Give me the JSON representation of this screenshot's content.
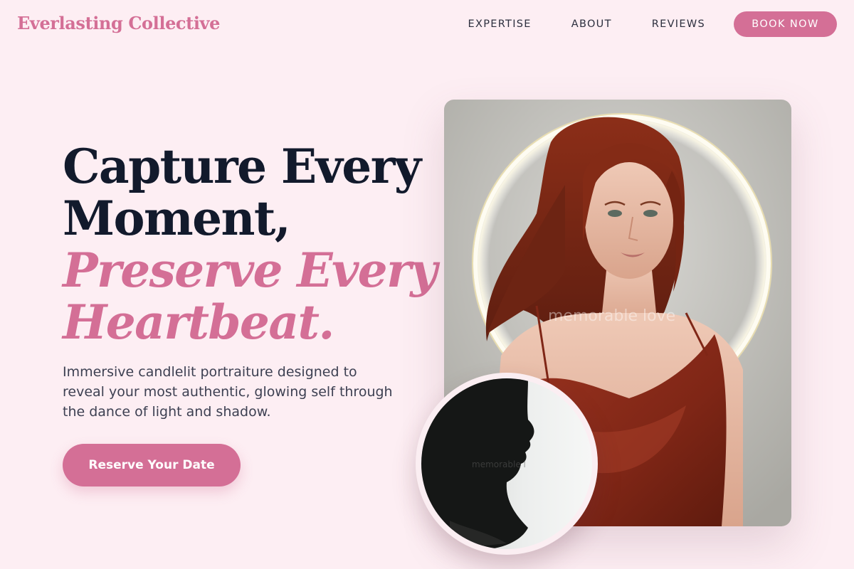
{
  "brand": {
    "name": "Everlasting Collective",
    "accent": "#d46f96"
  },
  "nav": {
    "items": [
      {
        "label": "EXPERTISE"
      },
      {
        "label": "ABOUT"
      },
      {
        "label": "REVIEWS"
      }
    ],
    "cta_label": "BOOK NOW"
  },
  "hero": {
    "title_line1": "Capture Every",
    "title_line2": "Moment,",
    "accent_line1": "Preserve Every",
    "accent_line2": "Heartbeat.",
    "subtitle": "Immersive candlelit portraiture designed to reveal your most authentic, glowing self through the dance of light and shadow.",
    "cta_label": "Reserve Your Date"
  },
  "photos": {
    "main": {
      "subject": "red-haired woman in rust satin dress with glowing halo ring",
      "watermark": "memorable love"
    },
    "inset": {
      "subject": "silhouette profile of man against bright window",
      "watermark": "memorable l"
    }
  },
  "colors": {
    "background": "#fdeef3",
    "heading": "#121a2c",
    "accent": "#d46f96",
    "body_text": "#3d4052"
  }
}
